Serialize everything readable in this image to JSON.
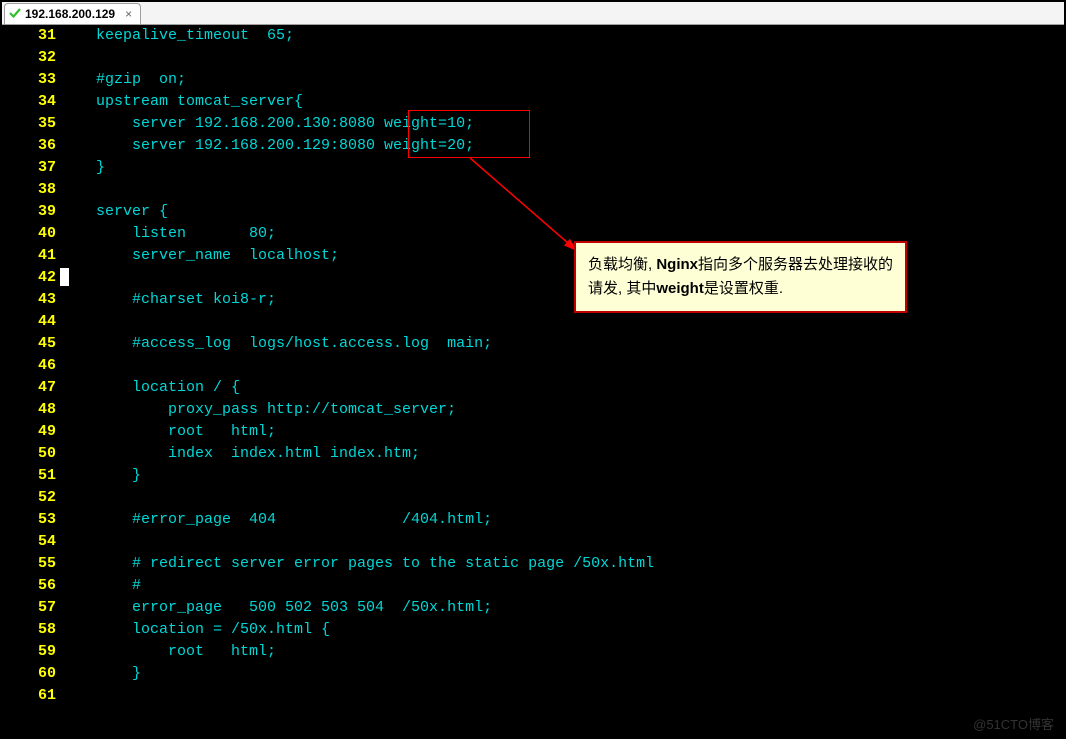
{
  "tab": {
    "title": "192.168.200.129",
    "close": "×"
  },
  "gutter": {
    "start": 31,
    "end": 61
  },
  "code": {
    "lines": [
      "    keepalive_timeout  65;",
      "",
      "    #gzip  on;",
      "    upstream tomcat_server{",
      "        server 192.168.200.130:8080 weight=10;",
      "        server 192.168.200.129:8080 weight=20;",
      "    }",
      "",
      "    server {",
      "        listen       80;",
      "        server_name  localhost;",
      "",
      "        #charset koi8-r;",
      "",
      "        #access_log  logs/host.access.log  main;",
      "",
      "        location / {",
      "            proxy_pass http://tomcat_server;",
      "            root   html;",
      "            index  index.html index.htm;",
      "        }",
      "",
      "        #error_page  404              /404.html;",
      "",
      "        # redirect server error pages to the static page /50x.html",
      "        #",
      "        error_page   500 502 503 504  /50x.html;",
      "        location = /50x.html {",
      "            root   html;",
      "        }",
      ""
    ]
  },
  "annotation": {
    "line1_a": "负载均衡, ",
    "line1_b": "Nginx",
    "line1_c": "指向多个服务器去处理接收的",
    "line2_a": "请发, 其中",
    "line2_b": "weight",
    "line2_c": "是设置权重."
  },
  "watermark": "@51CTO博客"
}
